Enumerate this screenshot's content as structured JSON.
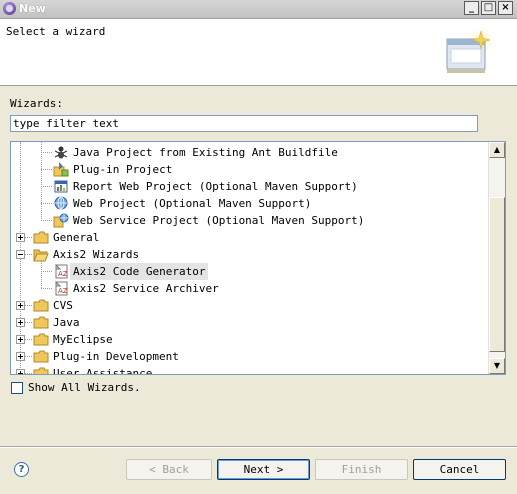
{
  "window": {
    "title": "New",
    "controls": {
      "minimize": "_",
      "maximize": "□",
      "close": "×"
    }
  },
  "header": {
    "title": "Select a wizard",
    "banner_icon": "wizard-banner-icon"
  },
  "wizards_label": "Wizards:",
  "filter": {
    "value": "type filter text",
    "placeholder": ""
  },
  "tree": {
    "items": [
      {
        "label": "Java Project from Existing Ant Buildfile",
        "icon": "ant-icon",
        "level": 1,
        "expander": "none"
      },
      {
        "label": "Plug-in Project",
        "icon": "plugin-project-icon",
        "level": 1,
        "expander": "none"
      },
      {
        "label": "Report Web Project (Optional Maven Support)",
        "icon": "report-web-project-icon",
        "level": 1,
        "expander": "none"
      },
      {
        "label": "Web Project (Optional Maven Support)",
        "icon": "web-project-icon",
        "level": 1,
        "expander": "none"
      },
      {
        "label": "Web Service Project (Optional Maven Support)",
        "icon": "web-service-project-icon",
        "level": 1,
        "expander": "none"
      },
      {
        "label": "General",
        "icon": "folder-icon",
        "level": 0,
        "expander": "closed"
      },
      {
        "label": "Axis2 Wizards",
        "icon": "folder-open-icon",
        "level": 0,
        "expander": "open"
      },
      {
        "label": "Axis2 Code Generator",
        "icon": "axis2-icon",
        "level": 1,
        "expander": "none",
        "selected": true
      },
      {
        "label": "Axis2 Service Archiver",
        "icon": "axis2-icon",
        "level": 1,
        "expander": "none"
      },
      {
        "label": "CVS",
        "icon": "folder-icon",
        "level": 0,
        "expander": "closed"
      },
      {
        "label": "Java",
        "icon": "folder-icon",
        "level": 0,
        "expander": "closed"
      },
      {
        "label": "MyEclipse",
        "icon": "folder-icon",
        "level": 0,
        "expander": "closed"
      },
      {
        "label": "Plug-in Development",
        "icon": "folder-icon",
        "level": 0,
        "expander": "closed"
      },
      {
        "label": "User Assistance",
        "icon": "folder-icon",
        "level": 0,
        "expander": "closed"
      }
    ]
  },
  "show_all": {
    "label": "Show All Wizards.",
    "checked": false
  },
  "buttons": {
    "back": "< Back",
    "next": "Next >",
    "finish": "Finish",
    "cancel": "Cancel"
  },
  "help_icon": "help-icon",
  "colors": {
    "dialog_bg": "#ece9d8",
    "selection": "#e4e4e4",
    "folder": "#f0c75a"
  }
}
